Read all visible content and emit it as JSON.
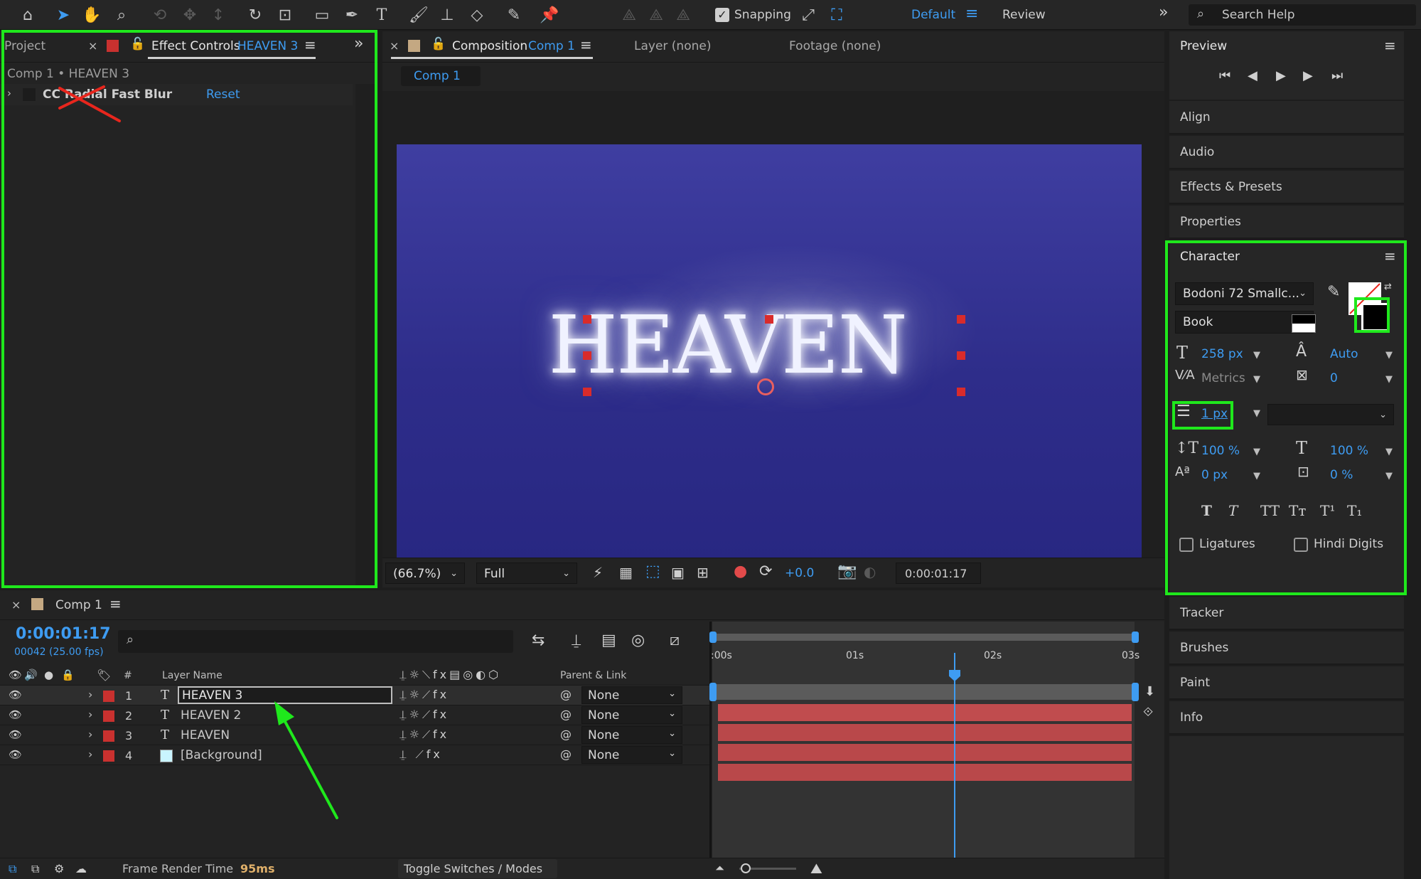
{
  "toolbar": {
    "snapping_label": "Snapping",
    "workspace_default": "Default",
    "workspace_review": "Review",
    "search_placeholder": "Search Help"
  },
  "left_panel": {
    "tab_project": "Project",
    "tab_effect_controls": "Effect Controls",
    "tab_effect_layer": "HEAVEN 3",
    "breadcrumb": "Comp 1 • HEAVEN 3",
    "effect_name": "CC Radial Fast Blur",
    "reset_label": "Reset"
  },
  "composition": {
    "tab_label": "Composition",
    "tab_comp_name": "Comp 1",
    "tab_layer": "Layer (none)",
    "tab_footage": "Footage (none)",
    "sub_tab": "Comp 1",
    "canvas_text": "HEAVEN",
    "zoom_value": "(66.7%)",
    "resolution_value": "Full",
    "exposure_value": "+0.0",
    "timecode": "0:00:01:17"
  },
  "right_panel": {
    "preview_title": "Preview",
    "items_top": [
      "Align",
      "Audio",
      "Effects & Presets",
      "Properties"
    ],
    "character_title": "Character",
    "font_family": "Bodoni 72 Smallc...",
    "font_style": "Book",
    "font_size": "258 px",
    "leading": "Auto",
    "kerning": "Metrics",
    "tracking": "0",
    "stroke_width": "1 px",
    "vertical_scale": "100 %",
    "horizontal_scale": "100 %",
    "baseline_shift": "0 px",
    "tsume": "0 %",
    "ligatures_label": "Ligatures",
    "hindi_digits_label": "Hindi Digits",
    "items_bottom": [
      "Tracker",
      "Brushes",
      "Paint",
      "Info"
    ]
  },
  "timeline": {
    "tab_label": "Comp 1",
    "timecode": "0:00:01:17",
    "frame_info": "00042 (25.00 fps)",
    "col_num": "#",
    "col_layer_name": "Layer Name",
    "col_parent": "Parent & Link",
    "ruler_ticks": [
      ":00s",
      "01s",
      "02s",
      "03s"
    ],
    "layers": [
      {
        "num": "1",
        "name": "HEAVEN 3",
        "parent": "None"
      },
      {
        "num": "2",
        "name": "HEAVEN 2",
        "parent": "None"
      },
      {
        "num": "3",
        "name": "HEAVEN",
        "parent": "None"
      },
      {
        "num": "4",
        "name": "[Background]",
        "parent": "None"
      }
    ],
    "frame_render_label": "Frame Render Time",
    "frame_render_value": "95ms",
    "toggle_label": "Toggle Switches / Modes"
  },
  "colors": {
    "accent_blue": "#3e9cf2",
    "highlight_green": "#1fe81c",
    "layer_label_red": "#c9312f",
    "annotation_red": "#e8261d"
  }
}
